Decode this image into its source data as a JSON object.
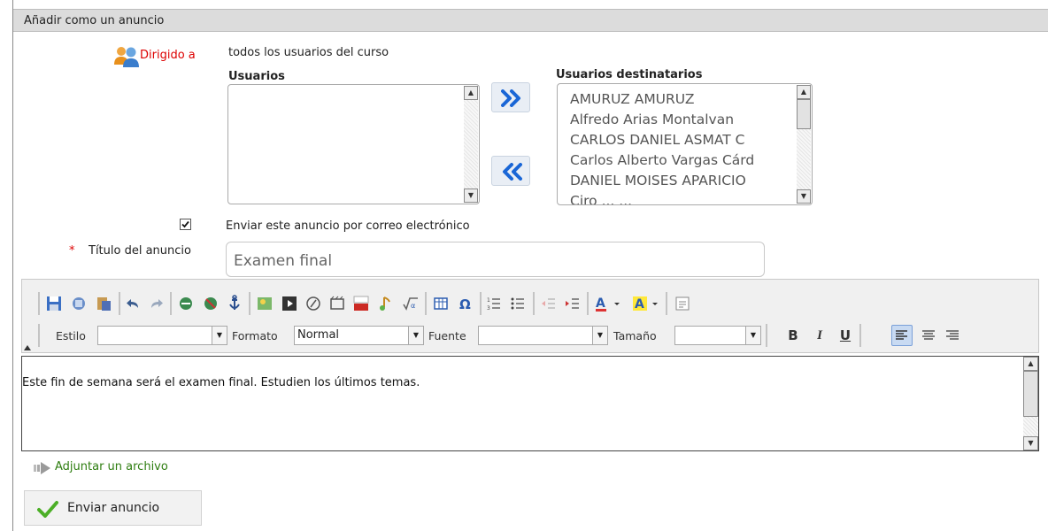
{
  "section_title": "Añadir como un anuncio",
  "recipients": {
    "label": "Dirigido a",
    "description": "todos los usuarios del curso",
    "users_label": "Usuarios",
    "users": [],
    "selected_label": "Usuarios destinatarios",
    "selected": [
      "AMURUZ AMURUZ",
      "Alfredo Arias Montalvan",
      "CARLOS DANIEL ASMAT C",
      "Carlos Alberto Vargas Cárd",
      "DANIEL MOISES APARICIO",
      "Ciro ... ..."
    ]
  },
  "email_option": {
    "label": "Enviar este anuncio por correo electrónico",
    "checked": true
  },
  "title_field": {
    "required_mark": "*",
    "label": "Título del anuncio",
    "value": "Examen final"
  },
  "editor": {
    "style_label": "Estilo",
    "style_value": "",
    "format_label": "Formato",
    "format_value": "Normal",
    "font_label": "Fuente",
    "font_value": "",
    "size_label": "Tamaño",
    "size_value": "",
    "bold": "B",
    "italic": "I",
    "underline": "U",
    "content": "Este fin de semana será el examen final. Estudien los últimos temas."
  },
  "attach_label": "Adjuntar un archivo",
  "send_button": "Enviar anuncio",
  "colors": {
    "header_bg": "#dcdcdc",
    "required": "#dd0000",
    "link_green": "#2e7d10",
    "arrow_blue": "#1a66d6"
  }
}
